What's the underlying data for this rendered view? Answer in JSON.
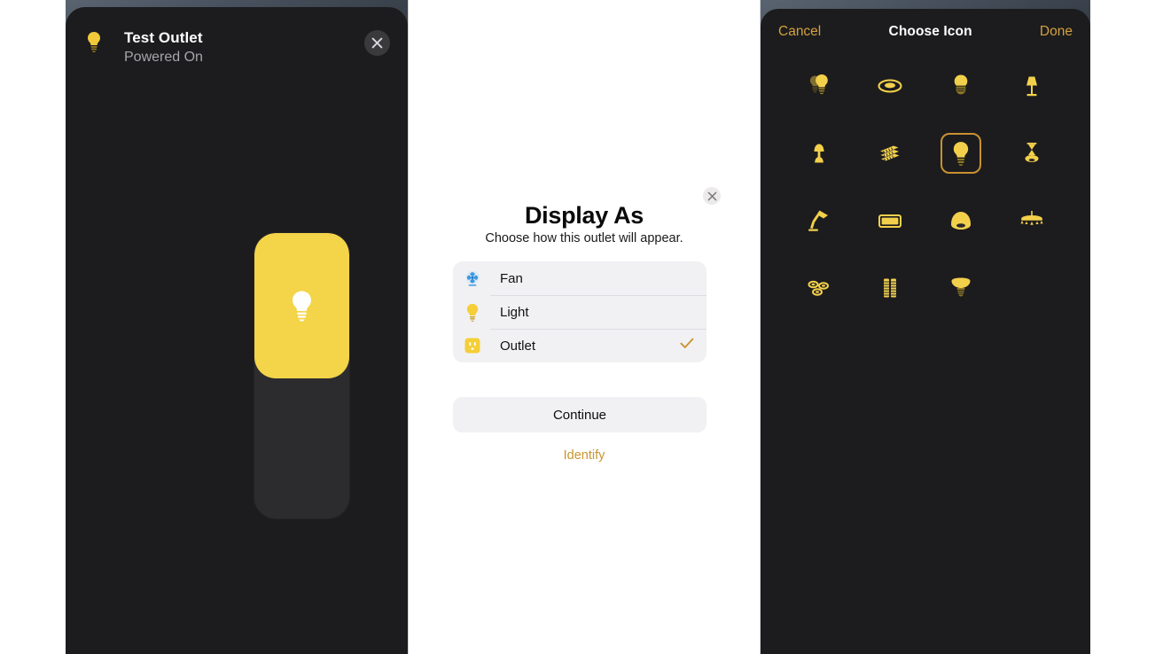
{
  "left_panel": {
    "device_icon": "lightbulb-icon",
    "title": "Test Outlet",
    "status": "Powered On",
    "close_icon": "close-icon",
    "slider": {
      "icon": "lightbulb-icon",
      "fill_percent": 51,
      "on_color": "#F4D448",
      "track_color": "#2C2C2E"
    }
  },
  "dialog": {
    "close_icon": "close-icon",
    "title": "Display As",
    "subtitle": "Choose how this outlet will appear.",
    "options": [
      {
        "icon": "fan-icon",
        "label": "Fan",
        "selected": false
      },
      {
        "icon": "lightbulb-icon",
        "label": "Light",
        "selected": false
      },
      {
        "icon": "outlet-icon",
        "label": "Outlet",
        "selected": true
      }
    ],
    "continue_label": "Continue",
    "identify_label": "Identify",
    "check_color": "#C9952F",
    "accent_color": "#C9952F"
  },
  "icon_picker": {
    "cancel_label": "Cancel",
    "title": "Choose Icon",
    "done_label": "Done",
    "accent_color": "#D4A13C",
    "selected_index": 6,
    "icons": [
      {
        "name": "two-bulbs-icon",
        "selected": false
      },
      {
        "name": "ring-light-icon",
        "selected": false
      },
      {
        "name": "led-bulb-icon",
        "selected": false
      },
      {
        "name": "table-lamp-icon",
        "selected": false
      },
      {
        "name": "small-lamp-icon",
        "selected": false
      },
      {
        "name": "light-strips-icon",
        "selected": false
      },
      {
        "name": "lightbulb-icon",
        "selected": true
      },
      {
        "name": "pendant-lamp-icon",
        "selected": false
      },
      {
        "name": "desk-lamp-icon",
        "selected": false
      },
      {
        "name": "panel-light-icon",
        "selected": false
      },
      {
        "name": "dome-light-icon",
        "selected": false
      },
      {
        "name": "chandelier-icon",
        "selected": false
      },
      {
        "name": "recessed-lights-icon",
        "selected": false
      },
      {
        "name": "light-tubes-icon",
        "selected": false
      },
      {
        "name": "flood-bulb-icon",
        "selected": false
      }
    ]
  }
}
